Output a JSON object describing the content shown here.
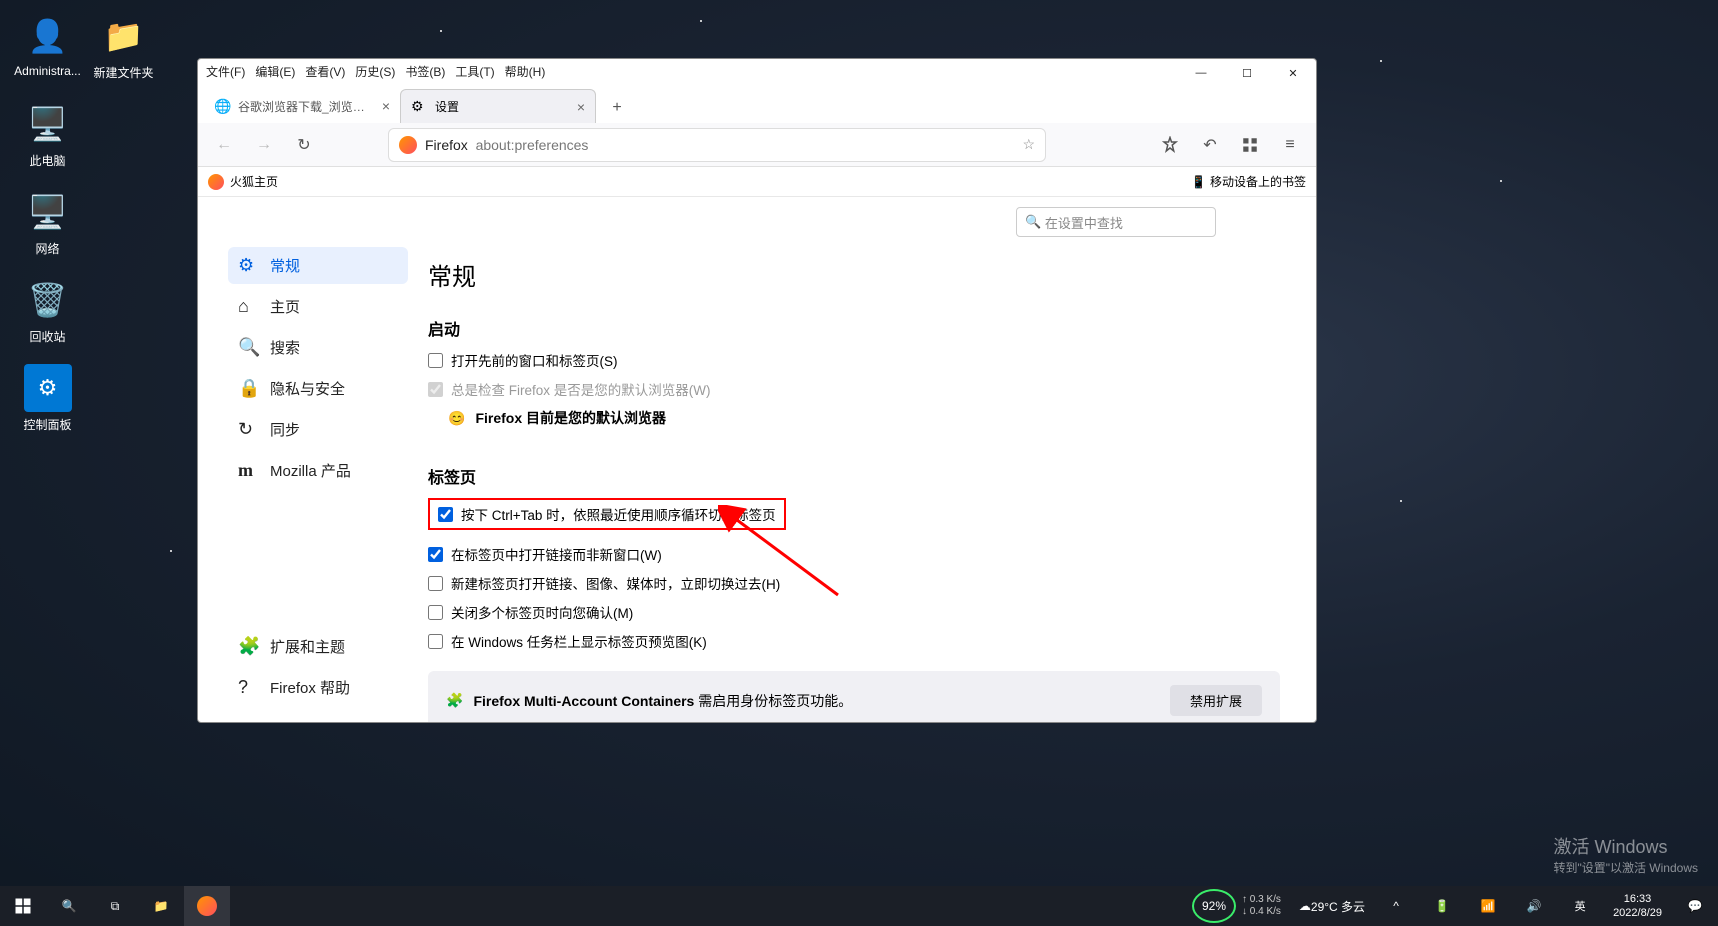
{
  "desktop": {
    "icons": [
      {
        "label": "Administra...",
        "name": "user-admin-icon"
      },
      {
        "label": "新建文件夹",
        "name": "new-folder-icon"
      },
      {
        "label": "此电脑",
        "name": "this-pc-icon"
      },
      {
        "label": "网络",
        "name": "network-icon"
      },
      {
        "label": "回收站",
        "name": "recycle-bin-icon"
      },
      {
        "label": "控制面板",
        "name": "control-panel-icon"
      }
    ]
  },
  "window": {
    "menubar": [
      "文件(F)",
      "编辑(E)",
      "查看(V)",
      "历史(S)",
      "书签(B)",
      "工具(T)",
      "帮助(H)"
    ],
    "tabs": [
      {
        "title": "谷歌浏览器下载_浏览器官网入口",
        "active": false,
        "favicon": "chrome"
      },
      {
        "title": "设置",
        "active": true,
        "favicon": "gear"
      }
    ],
    "url": {
      "prefix": "Firefox",
      "path": "about:preferences"
    },
    "bookmarkbar": {
      "left": "火狐主页",
      "right": "移动设备上的书签"
    },
    "controls": {
      "min": "—",
      "max": "☐",
      "close": "✕"
    }
  },
  "settings": {
    "search_placeholder": "在设置中查找",
    "sidebar": [
      {
        "label": "常规",
        "active": true
      },
      {
        "label": "主页",
        "active": false
      },
      {
        "label": "搜索",
        "active": false
      },
      {
        "label": "隐私与安全",
        "active": false
      },
      {
        "label": "同步",
        "active": false
      },
      {
        "label": "Mozilla 产品",
        "active": false
      }
    ],
    "sidebar_bottom": [
      {
        "label": "扩展和主题"
      },
      {
        "label": "Firefox 帮助"
      }
    ],
    "heading": "常规",
    "startup": {
      "title": "启动",
      "open_prev": "打开先前的窗口和标签页(S)",
      "always_check": "总是检查 Firefox 是否是您的默认浏览器(W)",
      "is_default": "Firefox 目前是您的默认浏览器"
    },
    "tabs": {
      "title": "标签页",
      "ctrl_tab": "按下 Ctrl+Tab 时，依照最近使用顺序循环切换标签页",
      "open_links": "在标签页中打开链接而非新窗口(W)",
      "new_media": "新建标签页打开链接、图像、媒体时，立即切换过去(H)",
      "close_multi": "关闭多个标签页时向您确认(M)",
      "windows_preview": "在 Windows 任务栏上显示标签页预览图(K)"
    },
    "extension": {
      "text": "Firefox Multi-Account Containers 需启用身份标签页功能。",
      "button": "禁用扩展"
    }
  },
  "taskbar": {
    "weather": "29°C 多云",
    "perf": "92%",
    "net": {
      "up": "0.3 K/s",
      "down": "0.4 K/s"
    },
    "time": "16:33",
    "date": "2022/8/29"
  },
  "watermark": {
    "line1": "激活 Windows",
    "line2": "转到\"设置\"以激活 Windows"
  }
}
